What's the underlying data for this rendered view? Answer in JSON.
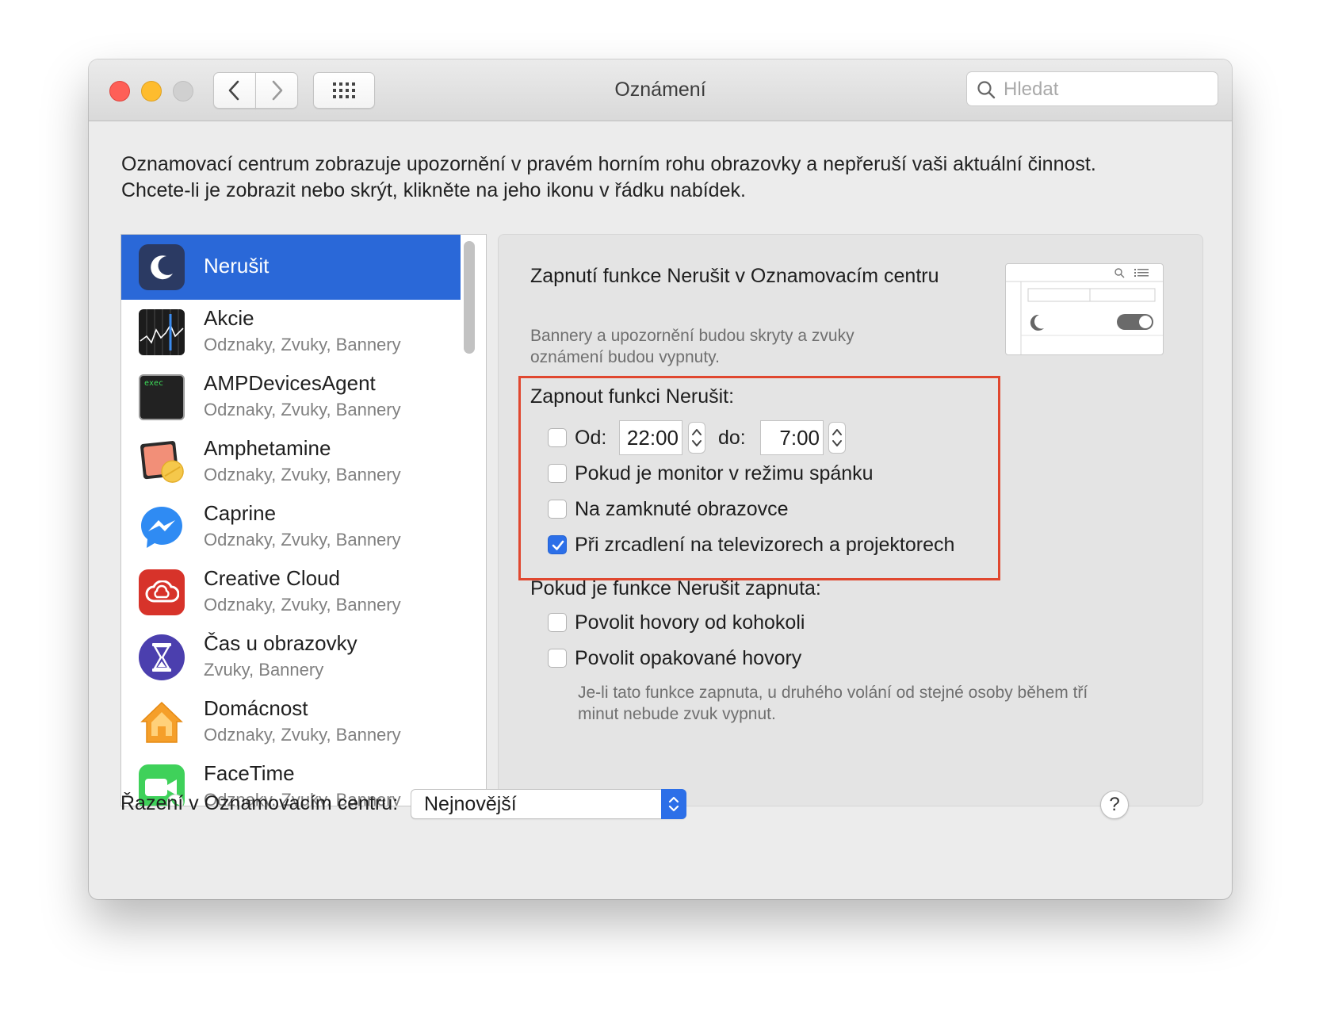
{
  "window": {
    "title": "Oznámení"
  },
  "search": {
    "placeholder": "Hledat"
  },
  "description": {
    "line1": "Oznamovací centrum zobrazuje upozornění v pravém horním rohu obrazovky a nepřeruší vaši aktuální činnost.",
    "line2": "Chcete-li je zobrazit nebo skrýt, klikněte na jeho ikonu v řádku nabídek."
  },
  "apps": [
    {
      "name": "Nerušit",
      "subtitle": "",
      "icon": "moon-icon",
      "selected": true
    },
    {
      "name": "Akcie",
      "subtitle": "Odznaky, Zvuky, Bannery",
      "icon": "stocks-icon"
    },
    {
      "name": "AMPDevicesAgent",
      "subtitle": "Odznaky, Zvuky, Bannery",
      "icon": "terminal-exec-icon",
      "icon_text": "exec"
    },
    {
      "name": "Amphetamine",
      "subtitle": "Odznaky, Zvuky, Bannery",
      "icon": "amphetamine-pill-icon"
    },
    {
      "name": "Caprine",
      "subtitle": "Odznaky, Zvuky, Bannery",
      "icon": "messenger-icon"
    },
    {
      "name": "Creative Cloud",
      "subtitle": "Odznaky, Zvuky, Bannery",
      "icon": "creative-cloud-icon"
    },
    {
      "name": "Čas u obrazovky",
      "subtitle": "Zvuky, Bannery",
      "icon": "hourglass-icon"
    },
    {
      "name": "Domácnost",
      "subtitle": "Odznaky, Zvuky, Bannery",
      "icon": "home-icon"
    },
    {
      "name": "FaceTime",
      "subtitle": "Odznaky, Zvuky, Bannery",
      "icon": "facetime-icon"
    }
  ],
  "panel": {
    "title": "Zapnutí funkce Nerušit v Oznamovacím centru",
    "description_line1": "Bannery a upozornění budou skryty a zvuky",
    "description_line2": "oznámení budou vypnuty.",
    "schedule": {
      "heading": "Zapnout funkci Nerušit:",
      "from_label": "Od:",
      "from_time": "22:00",
      "to_label": "do:",
      "to_time": "7:00",
      "from_checked": false
    },
    "options": [
      {
        "label": "Pokud je monitor v režimu spánku",
        "checked": false
      },
      {
        "label": "Na zamknuté obrazovce",
        "checked": false
      },
      {
        "label": "Při zrcadlení na televizorech a projektorech",
        "checked": true
      }
    ],
    "when_on": {
      "heading": "Pokud je funkce Nerušit zapnuta:",
      "options": [
        {
          "label": "Povolit hovory od kohokoli",
          "checked": false
        },
        {
          "label": "Povolit opakované hovory",
          "checked": false
        }
      ],
      "note_line1": "Je-li tato funkce zapnuta, u druhého volání od stejné osoby během tří",
      "note_line2": "minut nebude zvuk vypnut."
    }
  },
  "footer": {
    "sort_label": "Řazení v Oznamovacím centru:",
    "sort_value": "Nejnovější",
    "help_label": "?"
  },
  "colors": {
    "selection": "#2a68d8",
    "checkbox_checked": "#2c6fe8",
    "highlight_border": "#e0472f"
  }
}
